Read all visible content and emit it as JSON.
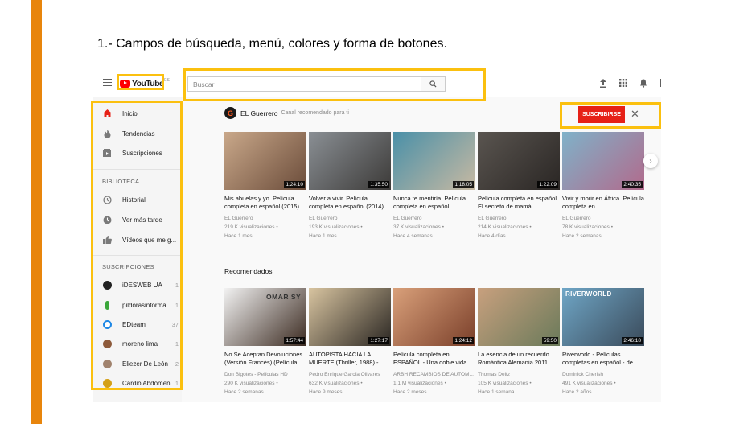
{
  "slide": {
    "title": "1.- Campos de búsqueda, menú, colores y forma de botones."
  },
  "header": {
    "logo_text": "YouTube",
    "logo_region": "ES",
    "search_placeholder": "Buscar"
  },
  "sidebar": {
    "main_items": [
      {
        "label": "Inicio",
        "icon": "home-icon"
      },
      {
        "label": "Tendencias",
        "icon": "flame-icon"
      },
      {
        "label": "Suscripciones",
        "icon": "subscriptions-icon"
      }
    ],
    "library_header": "BIBLIOTECA",
    "library_items": [
      {
        "label": "Historial",
        "icon": "history-icon"
      },
      {
        "label": "Ver más tarde",
        "icon": "clock-icon"
      },
      {
        "label": "Vídeos que me g...",
        "icon": "thumbs-up-icon"
      }
    ],
    "subs_header": "SUSCRIPCIONES",
    "subs": [
      {
        "label": "iDESWEB UA",
        "count": "1",
        "color": "#222222"
      },
      {
        "label": "pildorasinforma...",
        "count": "1",
        "color": "#3aa63a"
      },
      {
        "label": "EDteam",
        "count": "37",
        "color": "#1e88e5"
      },
      {
        "label": "moreno lima",
        "count": "1",
        "color": "#8d5a3b"
      },
      {
        "label": "Eliezer De León",
        "count": "2",
        "color": "#a0826d"
      },
      {
        "label": "Cardio Abdomen",
        "count": "1",
        "color": "#d4a017"
      }
    ]
  },
  "channel": {
    "avatar_letter": "G",
    "name": "EL Guerrero",
    "tagline": "Canal recomendado para ti",
    "subscribe_label": "SUSCRIBIRSE",
    "close_label": "✕"
  },
  "row1": [
    {
      "title": "Mis abuelas y yo. Película completa en español (2015)",
      "channel": "EL Guerrero",
      "views": "219 K visualizaciones •",
      "age": "Hace 1 mes",
      "duration": "1:24:10",
      "colors": [
        "#c9a88a",
        "#6b4c3a"
      ]
    },
    {
      "title": "Volver a vivir. Película completa en español (2014)",
      "channel": "EL Guerrero",
      "views": "193 K visualizaciones •",
      "age": "Hace 1 mes",
      "duration": "1:35:50",
      "colors": [
        "#8a8f94",
        "#3c3a38"
      ]
    },
    {
      "title": "Nunca te mentiría. Película completa en español",
      "channel": "EL Guerrero",
      "views": "37 K visualizaciones •",
      "age": "Hace 4 semanas",
      "duration": "1:18:05",
      "colors": [
        "#4a90a8",
        "#c7b9a2"
      ]
    },
    {
      "title": "Película completa en español. El secreto de mamá",
      "channel": "EL Guerrero",
      "views": "214 K visualizaciones •",
      "age": "Hace 4 días",
      "duration": "1:22:09",
      "colors": [
        "#5a5550",
        "#2a2624"
      ]
    },
    {
      "title": "Vivir y morir en África. Película completa en",
      "channel": "EL Guerrero",
      "views": "78 K visualizaciones •",
      "age": "Hace 2 semanas",
      "duration": "2:40:35",
      "colors": [
        "#7fb2c9",
        "#b26a8c"
      ]
    }
  ],
  "recommended_title": "Recomendados",
  "row2": [
    {
      "title": "No Se Aceptan Devoluciones (Versión Francés) (Película",
      "channel": "Don Bigotes - Películas HD",
      "views": "290 K visualizaciones •",
      "age": "Hace 2 semanas",
      "duration": "1:57:44",
      "colors": [
        "#f2f2f2",
        "#3b2a20"
      ],
      "overlay": "OMAR SY"
    },
    {
      "title": "AUTOPISTA HACIA LA MUERTE (Thriller, 1988) -",
      "channel": "Pedro Enrique García Olivares",
      "views": "632 K visualizaciones •",
      "age": "Hace 9 meses",
      "duration": "1:27:17",
      "colors": [
        "#d8c4a0",
        "#2a2622"
      ],
      "overlay": ""
    },
    {
      "title": "Película completa en ESPAÑOL - Una doble vida",
      "channel": "ARBH RECAMBIOS DE AUTOM...",
      "views": "1,1 M visualizaciones •",
      "age": "Hace 2 meses",
      "duration": "1:24:12",
      "colors": [
        "#d9a07a",
        "#7a3f2a"
      ],
      "overlay": ""
    },
    {
      "title": "La esencia de un recuerdo Romántica Alemania 2011",
      "channel": "Thomas Deitz",
      "views": "105 K visualizaciones •",
      "age": "Hace 1 semana",
      "duration": "59:50",
      "colors": [
        "#c8a07e",
        "#6a7a5a"
      ],
      "overlay": ""
    },
    {
      "title": "Riverworld - Películas completas en español - de",
      "channel": "Dominick Cherish",
      "views": "491 K visualizaciones •",
      "age": "Hace 2 años",
      "duration": "2:46:18",
      "colors": [
        "#6fa6c6",
        "#3a4a5a"
      ],
      "overlay": "RIVERWORLD"
    }
  ],
  "highlight_color": "#fbc00f",
  "accent_color": "#e8850c"
}
